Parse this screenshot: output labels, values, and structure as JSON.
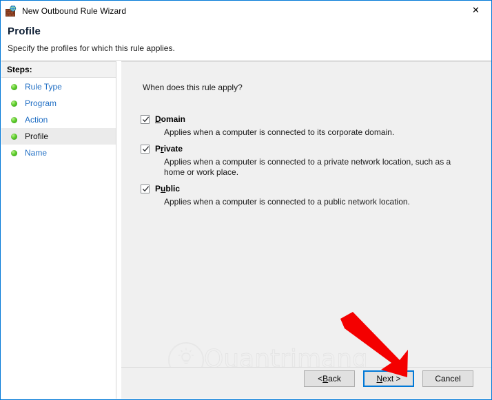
{
  "window": {
    "title": "New Outbound Rule Wizard",
    "icon": "firewall-globe-icon",
    "close_label": "✕",
    "border_color": "#0078d7"
  },
  "header": {
    "title": "Profile",
    "subtitle": "Specify the profiles for which this rule applies."
  },
  "sidebar": {
    "header_label": "Steps:",
    "items": [
      {
        "label": "Rule Type",
        "current": false
      },
      {
        "label": "Program",
        "current": false
      },
      {
        "label": "Action",
        "current": false
      },
      {
        "label": "Profile",
        "current": true
      },
      {
        "label": "Name",
        "current": false
      }
    ],
    "bullet_color": "#5fce2e",
    "link_color": "#1f6ec4"
  },
  "main": {
    "question": "When does this rule apply?",
    "options": [
      {
        "label": "Domain",
        "accel_before": "",
        "accel": "D",
        "accel_after": "omain",
        "description": "Applies when a computer is connected to its corporate domain.",
        "checked": true
      },
      {
        "label": "Private",
        "accel_before": "P",
        "accel": "r",
        "accel_after": "ivate",
        "description": "Applies when a computer is connected to a private network location, such as a home or work place.",
        "checked": true
      },
      {
        "label": "Public",
        "accel_before": "P",
        "accel": "u",
        "accel_after": "blic",
        "description": "Applies when a computer is connected to a public network location.",
        "checked": true
      }
    ]
  },
  "footer": {
    "back": {
      "before": "< ",
      "accel": "B",
      "after": "ack"
    },
    "next": {
      "before": "",
      "accel": "N",
      "after": "ext >"
    },
    "cancel_label": "Cancel",
    "focus_color": "#0078d7"
  },
  "watermark": {
    "text": "Quantrimang",
    "logo": "lightbulb-circle-logo"
  },
  "annotation": {
    "arrow": "red-down-right-arrow",
    "arrow_color": "#f40000",
    "points_to": "Next >"
  }
}
